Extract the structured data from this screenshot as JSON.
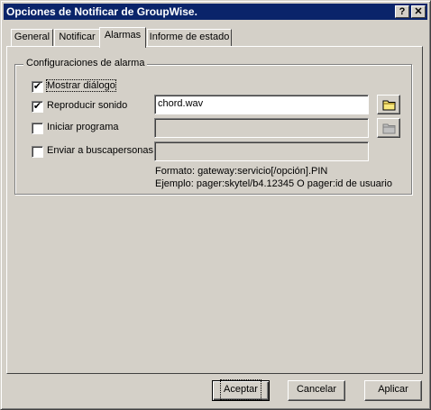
{
  "window": {
    "title": "Opciones de Notificar de GroupWise.",
    "help_glyph": "?",
    "close_glyph": "✕"
  },
  "tabs": [
    {
      "label": "General"
    },
    {
      "label": "Notificar"
    },
    {
      "label": "Alarmas",
      "active": true
    },
    {
      "label": "Informe de estado"
    }
  ],
  "alarm_settings": {
    "group_label": "Configuraciones de alarma",
    "show_dialog": {
      "label": "Mostrar diálogo",
      "checked": true
    },
    "play_sound": {
      "label": "Reproducir sonido",
      "checked": true,
      "file_value": "chord.wav"
    },
    "start_program": {
      "label": "Iniciar programa",
      "checked": false,
      "file_value": ""
    },
    "pager": {
      "label": "Enviar a buscapersonas",
      "checked": false,
      "value": "",
      "format_text": "Formato: gateway:servicio[/opción].PIN",
      "example_text": "Ejemplo: pager:skytel/b4.12345 O pager:id de usuario"
    },
    "browse_icon": "folder-icon"
  },
  "buttons": {
    "ok_label": "Aceptar",
    "cancel_label": "Cancelar",
    "apply_label": "Aplicar"
  },
  "colors": {
    "titlebar": "#0a246a",
    "face": "#d4d0c8",
    "folder": "#f8e87c"
  }
}
